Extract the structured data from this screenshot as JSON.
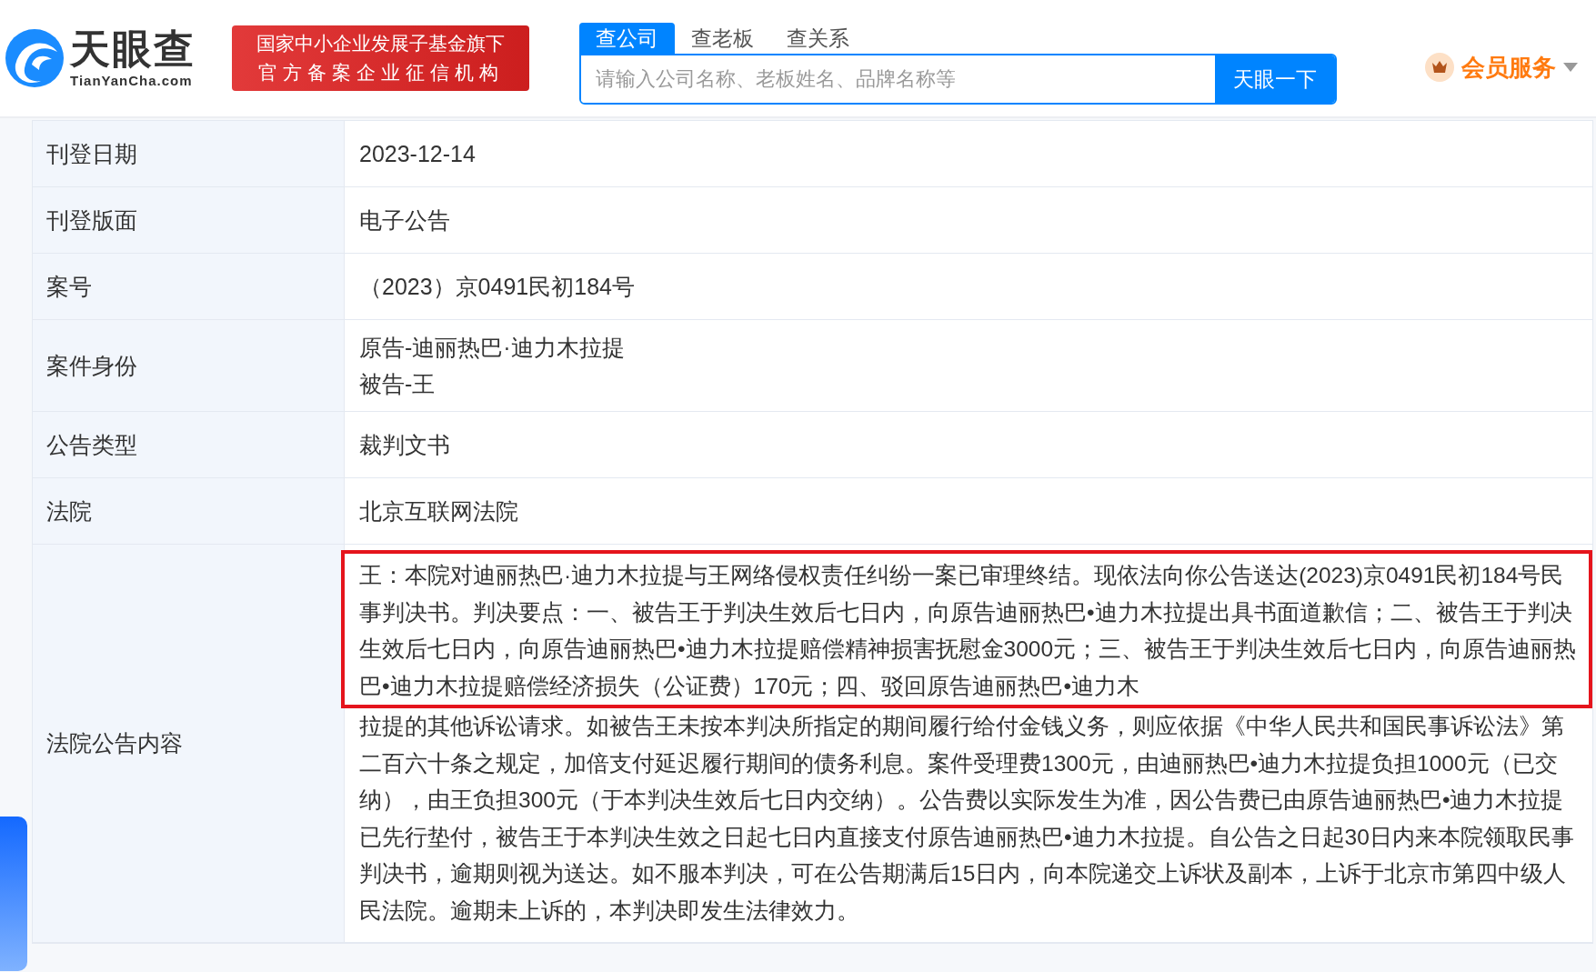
{
  "header": {
    "logo": {
      "name": "天眼查",
      "domain": "TianYanCha.com"
    },
    "badge": [
      "国家中小企业发展子基金旗下",
      "官方备案企业征信机构"
    ],
    "search_tabs": [
      {
        "label": "查公司",
        "selected": true
      },
      {
        "label": "查老板",
        "selected": false
      },
      {
        "label": "查关系",
        "selected": false
      }
    ],
    "search": {
      "placeholder": "请输入公司名称、老板姓名、品牌名称等",
      "button": "天眼一下"
    },
    "member": {
      "label": "会员服务"
    }
  },
  "table": {
    "rows": [
      {
        "label": "刊登日期",
        "values": [
          "2023-12-14"
        ]
      },
      {
        "label": "刊登版面",
        "values": [
          "电子公告"
        ]
      },
      {
        "label": "案号",
        "values": [
          "（2023）京0491民初184号"
        ]
      },
      {
        "label": "案件身份",
        "values": [
          "原告-迪丽热巴·迪力木拉提",
          "被告-王"
        ]
      },
      {
        "label": "公告类型",
        "values": [
          "裁判文书"
        ]
      },
      {
        "label": "法院",
        "values": [
          "北京互联网法院"
        ]
      }
    ],
    "content_row": {
      "label": "法院公告内容",
      "parts": [
        {
          "highlighted": true,
          "text": "王：本院对迪丽热巴·迪力木拉提与王网络侵权责任纠纷一案已审理终结。现依法向你公告送达(2023)京0491民初184号民事判决书。判决要点：一、被告王于判决生效后七日内，向原告迪丽热巴•迪力木拉提出具书面道歉信；二、被告王于判决生效后七日内，向原告迪丽热巴•迪力木拉提赔偿精神损害抚慰金3000元；三、被告王于判决生效后七日内，向原告迪丽热巴•迪力木拉提赔偿经济损失（公证费）170元；四、驳回原告迪丽热巴•迪力木"
        },
        {
          "highlighted": false,
          "text": "拉提的其他诉讼请求。如被告王未按本判决所指定的期间履行给付金钱义务，则应依据《中华人民共和国民事诉讼法》第二百六十条之规定，加倍支付延迟履行期间的债务利息。案件受理费1300元，由迪丽热巴•迪力木拉提负担1000元（已交纳），由王负担300元（于本判决生效后七日内交纳）。公告费以实际发生为准，因公告费已由原告迪丽热巴•迪力木拉提已先行垫付，被告王于本判决生效之日起七日内直接支付原告迪丽热巴•迪力木拉提。自公告之日起30日内来本院领取民事判决书，逾期则视为送达。如不服本判决，可在公告期满后15日内，向本院递交上诉状及副本，上诉于北京市第四中级人民法院。逾期未上诉的，本判决即发生法律效力。"
        }
      ]
    }
  }
}
